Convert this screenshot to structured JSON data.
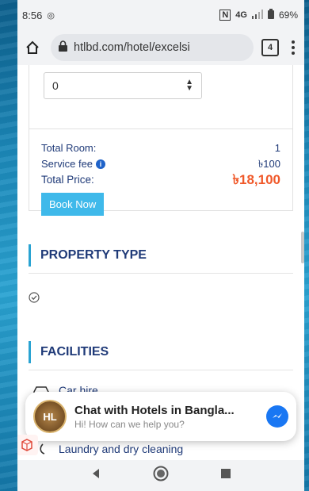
{
  "status": {
    "time": "8:56",
    "network": "4G",
    "battery": "69%"
  },
  "browser": {
    "url": "htlbd.com/hotel/excelsi",
    "tab_count": "4"
  },
  "booking": {
    "select_value": "0",
    "total_room_label": "Total Room:",
    "total_room_value": "1",
    "service_fee_label": "Service fee",
    "service_fee_value": "৳100",
    "total_price_label": "Total Price:",
    "total_price_value": "৳18,100",
    "book_button": "Book Now"
  },
  "sections": {
    "property_type": "PROPERTY TYPE",
    "facilities": "FACILITIES"
  },
  "facilities": [
    "Car hire",
    "Laundry and dry cleaning"
  ],
  "chat": {
    "logo_text": "HL",
    "title": "Chat with Hotels in Bangla...",
    "subtitle": "Hi! How can we help you?"
  },
  "colors": {
    "accent": "#2aa3d2",
    "price": "#f0592a",
    "text_navy": "#1f3a78",
    "messenger": "#1977f3"
  }
}
